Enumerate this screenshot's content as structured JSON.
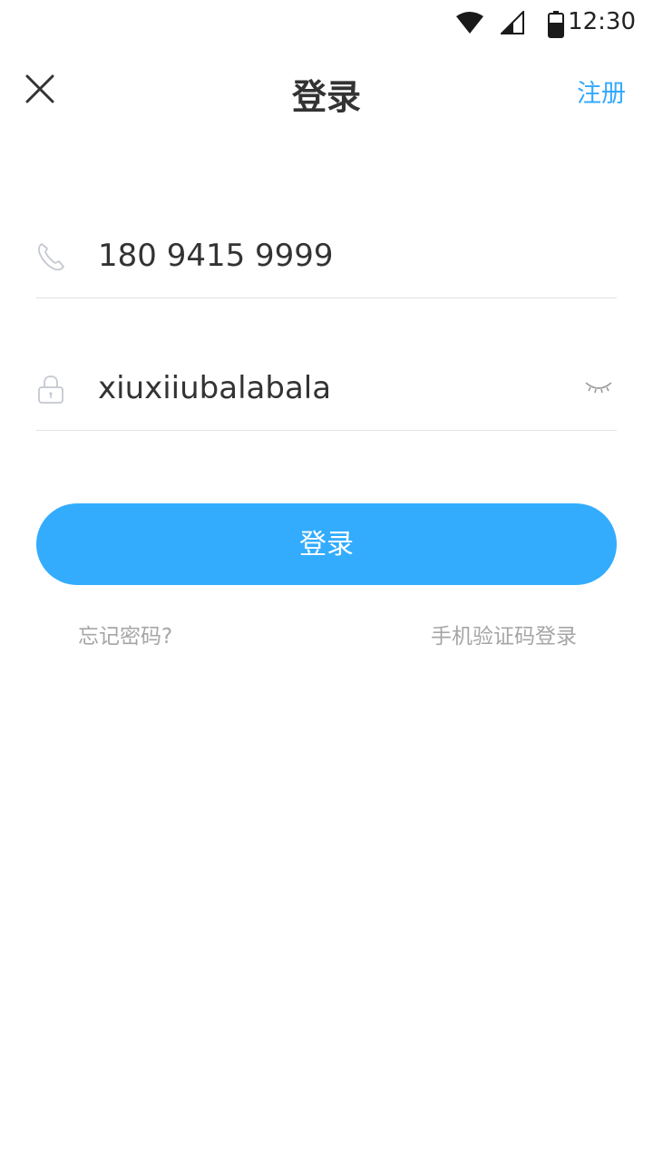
{
  "status_bar": {
    "time": "12:30",
    "icons": [
      "wifi-icon",
      "signal-icon",
      "battery-icon"
    ]
  },
  "nav": {
    "close_icon": "close-icon",
    "title": "登录",
    "register_label": "注册"
  },
  "form": {
    "phone": {
      "icon": "phone-icon",
      "value": "180 9415 9999"
    },
    "password": {
      "icon": "lock-icon",
      "value": "xiuxiiubalabala",
      "visibility_icon": "eye-closed-icon"
    },
    "login_button_label": "登录"
  },
  "links": {
    "forgot_password": "忘记密码?",
    "sms_login": "手机验证码登录"
  },
  "colors": {
    "accent": "#33acfe",
    "link_gray": "#a6a6a6",
    "divider": "#e3e3e6",
    "text": "#333333"
  }
}
